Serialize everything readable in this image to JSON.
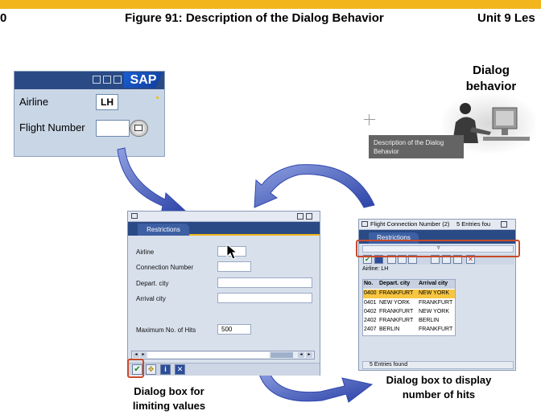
{
  "header": {
    "left_num": "0",
    "title": "Figure 91: Description of the Dialog Behavior",
    "unit": "Unit 9 Les"
  },
  "sap_screen": {
    "logo": "SAP",
    "airline_label": "Airline",
    "airline_value": "LH",
    "flight_number_label": "Flight Number"
  },
  "dialog_behavior": {
    "title_line1": "Dialog",
    "title_line2": "behavior",
    "tooltip_line1": "Description of the Dialog",
    "tooltip_line2": "Behavior"
  },
  "restrictions_dialog": {
    "tab_label": "Restrictions",
    "fields": [
      {
        "label": "Airline",
        "value": ""
      },
      {
        "label": "Connection Number",
        "value": ""
      },
      {
        "label": "Depart. city",
        "value": ""
      },
      {
        "label": "Arrival city",
        "value": ""
      },
      {
        "label": "Maximum No. of Hits",
        "value": "500"
      }
    ],
    "caption_line1": "Dialog box for",
    "caption_line2": "limiting values"
  },
  "hits_dialog": {
    "title": "Flight Connection Number (2)",
    "entries_count_title": "5 Entries fou",
    "tab_label": "Restrictions",
    "airline_filter": "Airline: LH",
    "columns": [
      "No.",
      "Depart. city",
      "Arrival city"
    ],
    "rows": [
      {
        "no": "0400",
        "dep": "FRANKFURT",
        "arr": "NEW YORK"
      },
      {
        "no": "0401",
        "dep": "NEW YORK",
        "arr": "FRANKFURT"
      },
      {
        "no": "0402",
        "dep": "FRANKFURT",
        "arr": "NEW YORK"
      },
      {
        "no": "2402",
        "dep": "FRANKFURT",
        "arr": "BERLIN"
      },
      {
        "no": "2407",
        "dep": "BERLIN",
        "arr": "FRANKFURT"
      }
    ],
    "footer": "5 Entries found",
    "caption_line1": "Dialog box to display",
    "caption_line2": "number of hits"
  },
  "colors": {
    "accent": "#f2b51c",
    "sap_blue": "#2a4a86",
    "arrow_blue": "#3f56b8",
    "highlight_red": "#c84a2a",
    "selected_row": "#f7c542"
  }
}
